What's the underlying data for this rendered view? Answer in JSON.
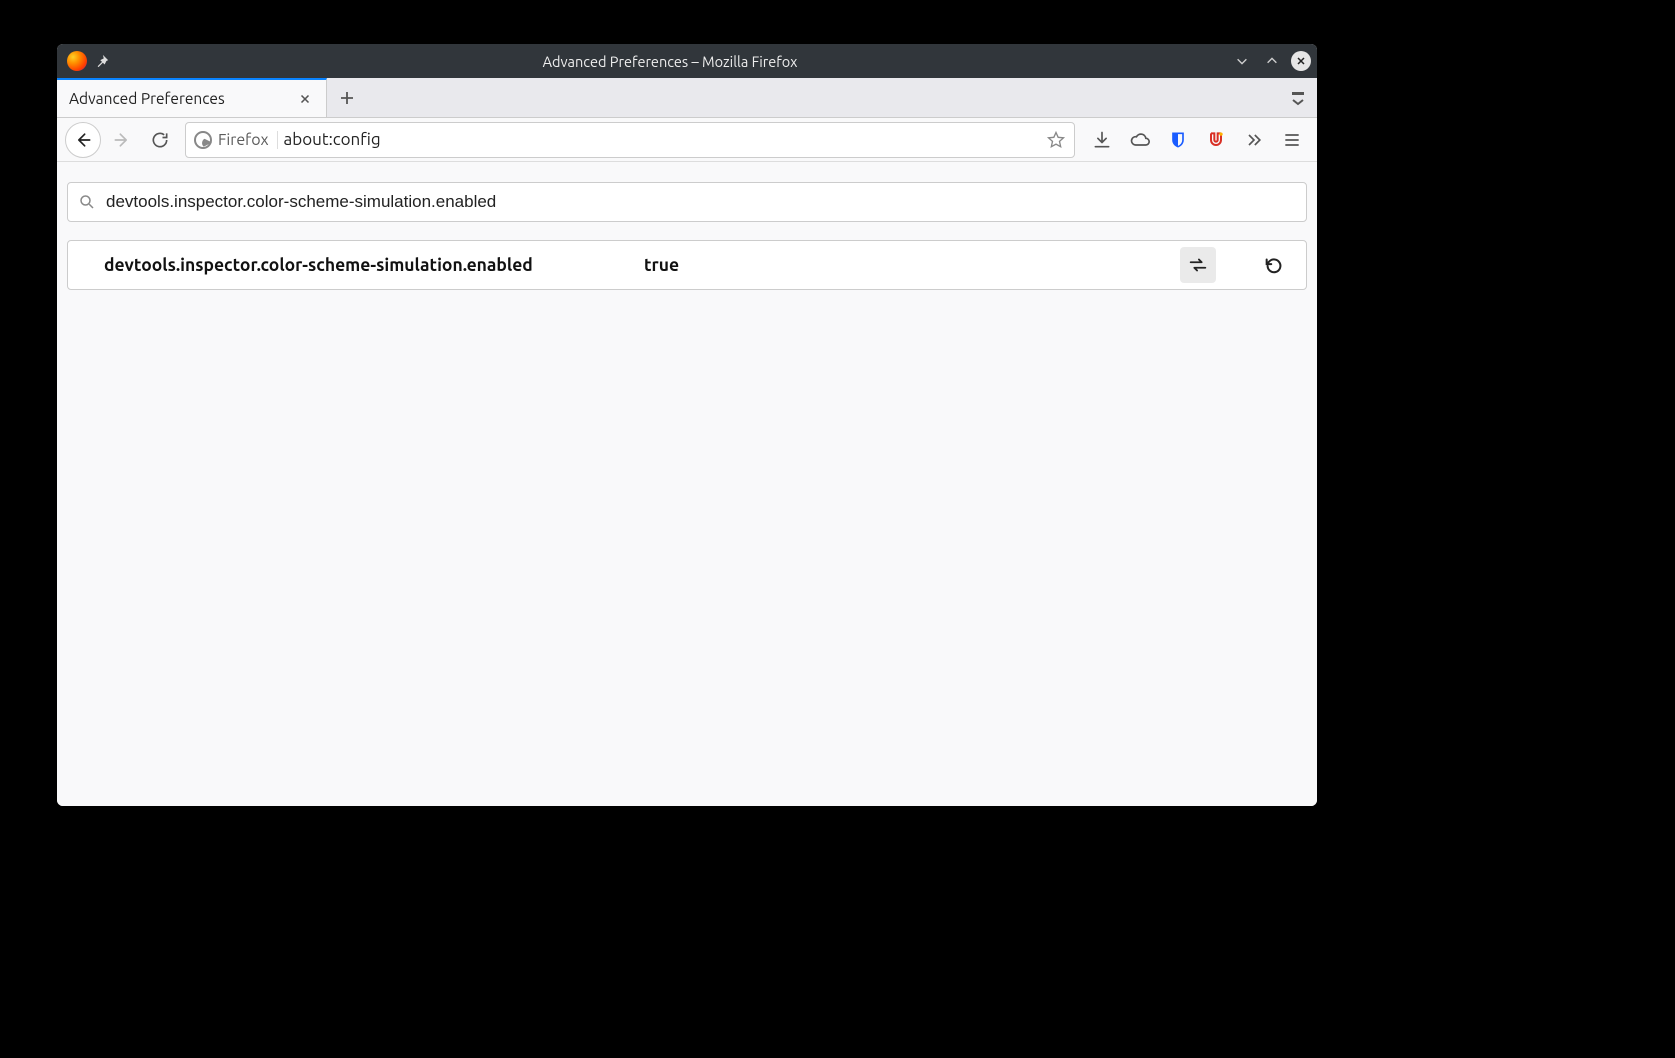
{
  "window": {
    "title": "Advanced Preferences – Mozilla Firefox"
  },
  "tab": {
    "title": "Advanced Preferences"
  },
  "urlbar": {
    "identity_label": "Firefox",
    "url": "about:config"
  },
  "search": {
    "value": "devtools.inspector.color-scheme-simulation.enabled"
  },
  "pref": {
    "name": "devtools.inspector.color-scheme-simulation.enabled",
    "value": "true"
  }
}
